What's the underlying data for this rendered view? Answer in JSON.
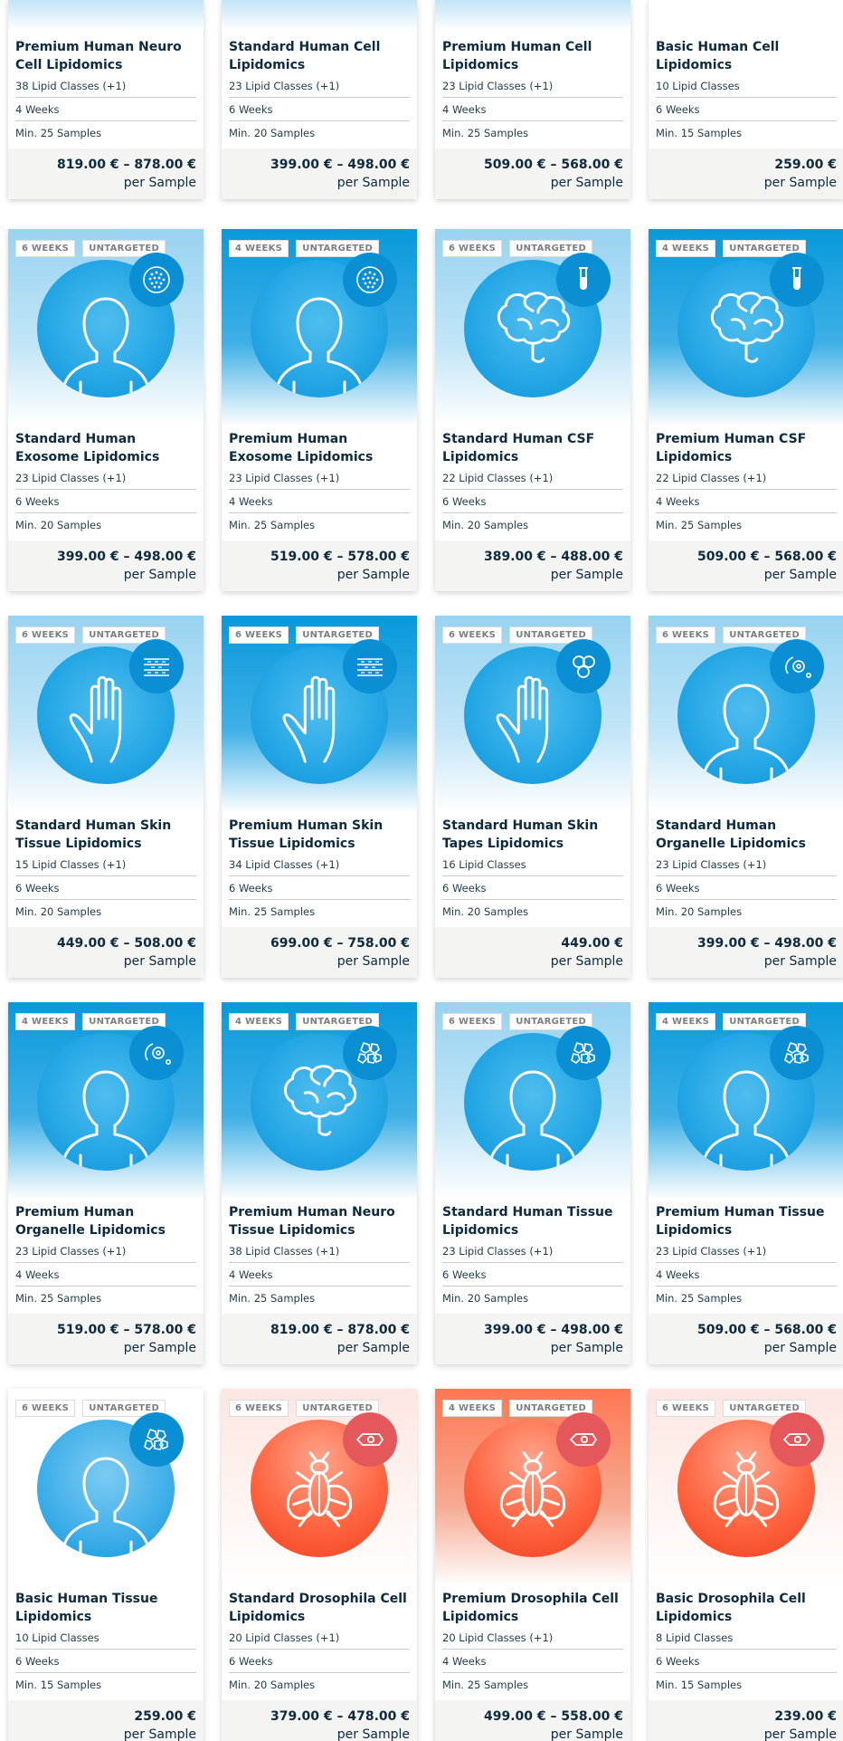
{
  "badge_untargeted": "UNTARGETED",
  "per_label": "per Sample",
  "cards": [
    {
      "title": "Premium Human Neuro Cell Lipidomics",
      "classes": "38 Lipid Classes (+1)",
      "weeks": "4 Weeks",
      "samples": "Min. 25 Samples",
      "price": "819.00 € – 878.00 €"
    },
    {
      "title": "Standard Human Cell Lipidomics",
      "classes": "23 Lipid Classes (+1)",
      "weeks": "6 Weeks",
      "samples": "Min. 20 Samples",
      "price": "399.00 € – 498.00 €"
    },
    {
      "title": "Premium Human Cell Lipidomics",
      "classes": "23 Lipid Classes (+1)",
      "weeks": "4 Weeks",
      "samples": "Min. 25 Samples",
      "price": "509.00 € – 568.00 €"
    },
    {
      "title": "Basic Human Cell Lipidomics",
      "classes": "10 Lipid Classes",
      "weeks": "6 Weeks",
      "samples": "Min. 15 Samples",
      "price": "259.00 €"
    },
    {
      "title": "Standard Human Exosome Lipidomics",
      "classes": "23 Lipid Classes (+1)",
      "weeks": "6 Weeks",
      "samples": "Min. 20 Samples",
      "price": "399.00 € – 498.00 €",
      "badge_weeks": "6 WEEKS",
      "icon": "person-icon",
      "mini_icon": "exosome-icon"
    },
    {
      "title": "Premium Human Exosome Lipidomics",
      "classes": "23 Lipid Classes (+1)",
      "weeks": "4 Weeks",
      "samples": "Min. 25 Samples",
      "price": "519.00 € – 578.00 €",
      "badge_weeks": "4 WEEKS",
      "icon": "person-icon",
      "mini_icon": "exosome-icon"
    },
    {
      "title": "Standard Human CSF Lipidomics",
      "classes": "22 Lipid Classes (+1)",
      "weeks": "6 Weeks",
      "samples": "Min. 20 Samples",
      "price": "389.00 € – 488.00 €",
      "badge_weeks": "6 WEEKS",
      "icon": "brain-icon",
      "mini_icon": "test-tube-icon"
    },
    {
      "title": "Premium Human CSF Lipidomics",
      "classes": "22 Lipid Classes (+1)",
      "weeks": "4 Weeks",
      "samples": "Min. 25 Samples",
      "price": "509.00 € – 568.00 €",
      "badge_weeks": "4 WEEKS",
      "icon": "brain-icon",
      "mini_icon": "test-tube-icon"
    },
    {
      "title": "Standard Human Skin Tissue Lipidomics",
      "classes": "15 Lipid Classes (+1)",
      "weeks": "6 Weeks",
      "samples": "Min. 20 Samples",
      "price": "449.00 € – 508.00 €",
      "badge_weeks": "6 WEEKS",
      "icon": "hand-icon",
      "mini_icon": "skin-layers-icon"
    },
    {
      "title": "Premium Human Skin Tissue Lipidomics",
      "classes": "34 Lipid Classes (+1)",
      "weeks": "6 Weeks",
      "samples": "Min. 25 Samples",
      "price": "699.00 € – 758.00 €",
      "badge_weeks": "6 WEEKS",
      "icon": "hand-icon",
      "mini_icon": "skin-layers-icon"
    },
    {
      "title": "Standard Human Skin Tapes Lipidomics",
      "classes": "16 Lipid Classes",
      "weeks": "6 Weeks",
      "samples": "Min. 20 Samples",
      "price": "449.00 €",
      "badge_weeks": "6 WEEKS",
      "icon": "hand-icon",
      "mini_icon": "skin-tape-icon"
    },
    {
      "title": "Standard Human Organelle Lipidomics",
      "classes": "23 Lipid Classes (+1)",
      "weeks": "6 Weeks",
      "samples": "Min. 20 Samples",
      "price": "399.00 € – 498.00 €",
      "badge_weeks": "6 WEEKS",
      "icon": "person-icon",
      "mini_icon": "organelle-icon"
    },
    {
      "title": "Premium Human Organelle Lipidomics",
      "classes": "23 Lipid Classes (+1)",
      "weeks": "4 Weeks",
      "samples": "Min. 25 Samples",
      "price": "519.00 € – 578.00 €",
      "badge_weeks": "4 WEEKS",
      "icon": "person-icon",
      "mini_icon": "organelle-icon"
    },
    {
      "title": "Premium Human Neuro Tissue Lipidomics",
      "classes": "38 Lipid Classes (+1)",
      "weeks": "4 Weeks",
      "samples": "Min. 25 Samples",
      "price": "819.00 € – 878.00 €",
      "badge_weeks": "4 WEEKS",
      "icon": "brain-icon",
      "mini_icon": "tissue-cells-icon"
    },
    {
      "title": "Standard Human Tissue Lipidomics",
      "classes": "23 Lipid Classes (+1)",
      "weeks": "6 Weeks",
      "samples": "Min. 20 Samples",
      "price": "399.00 € – 498.00 €",
      "badge_weeks": "6 WEEKS",
      "icon": "person-icon",
      "mini_icon": "tissue-cells-icon"
    },
    {
      "title": "Premium Human Tissue Lipidomics",
      "classes": "23 Lipid Classes (+1)",
      "weeks": "4 Weeks",
      "samples": "Min. 25 Samples",
      "price": "509.00 € – 568.00 €",
      "badge_weeks": "4 WEEKS",
      "icon": "person-icon",
      "mini_icon": "tissue-cells-icon"
    },
    {
      "title": "Basic Human Tissue Lipidomics",
      "classes": "10 Lipid Classes",
      "weeks": "6 Weeks",
      "samples": "Min. 15 Samples",
      "price": "259.00 €",
      "badge_weeks": "6 WEEKS",
      "icon": "person-icon",
      "mini_icon": "tissue-cells-icon"
    },
    {
      "title": "Standard Drosophila Cell Lipidomics",
      "classes": "20 Lipid Classes (+1)",
      "weeks": "6 Weeks",
      "samples": "Min. 20 Samples",
      "price": "379.00 € – 478.00 €",
      "badge_weeks": "6 WEEKS",
      "icon": "fly-icon",
      "mini_icon": "cell-icon"
    },
    {
      "title": "Premium Drosophila Cell Lipidomics",
      "classes": "20 Lipid Classes (+1)",
      "weeks": "4 Weeks",
      "samples": "Min. 25 Samples",
      "price": "499.00 € – 558.00 €",
      "badge_weeks": "4 WEEKS",
      "icon": "fly-icon",
      "mini_icon": "cell-icon"
    },
    {
      "title": "Basic Drosophila Cell Lipidomics",
      "classes": "8 Lipid Classes",
      "weeks": "6 Weeks",
      "samples": "Min. 15 Samples",
      "price": "239.00 €",
      "badge_weeks": "6 WEEKS",
      "icon": "fly-icon",
      "mini_icon": "cell-icon"
    }
  ]
}
